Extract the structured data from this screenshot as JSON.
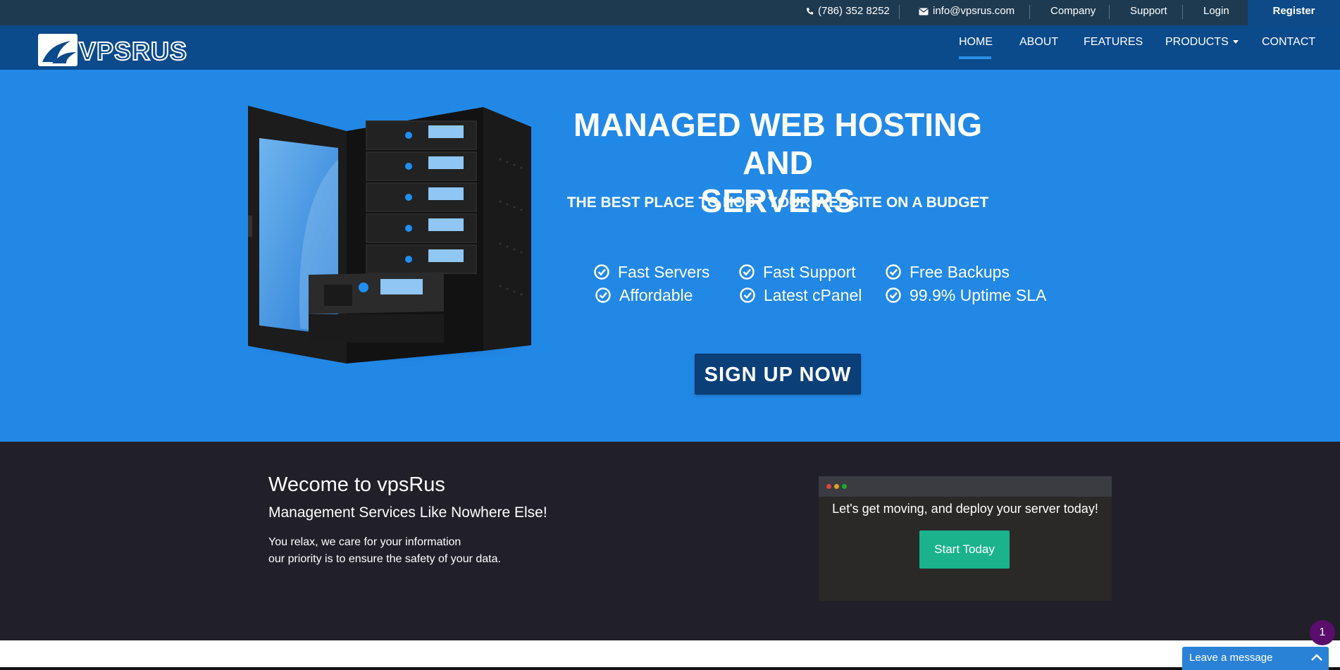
{
  "topbar": {
    "phone": "(786) 352 8252",
    "email": "info@vpsrus.com",
    "links": [
      "Company",
      "Support",
      "Login"
    ],
    "register": "Register"
  },
  "nav": {
    "logo_text": "VPSRUS",
    "items": [
      "HOME",
      "ABOUT",
      "FEATURES",
      "PRODUCTS",
      "CONTACT"
    ],
    "active": "HOME"
  },
  "hero": {
    "title_line1": "MANAGED WEB HOSTING AND",
    "title_line2": "SERVERS",
    "subtitle": "THE BEST PLACE TO HOST YOUR WEBSITE ON A BUDGET",
    "features": [
      "Fast Servers",
      "Fast Support",
      "Free Backups",
      "Affordable",
      "Latest cPanel",
      "99.9% Uptime SLA"
    ],
    "cta": "SIGN UP NOW"
  },
  "welcome": {
    "title": "Wecome to vpsRus",
    "subtitle": "Management Services Like Nowhere Else!",
    "line1": "You relax, we care for your information",
    "line2": "our priority is to ensure the safety of your data."
  },
  "deploy_card": {
    "text": "Let's get moving, and deploy your server today!",
    "button": "Start Today"
  },
  "widgets": {
    "notification_count": "1",
    "chat_label": "Leave a message"
  },
  "colors": {
    "topbar": "#1e3a50",
    "navbar": "#0b4a8b",
    "hero": "#2288e6",
    "dark": "#211f28",
    "accent_green": "#1bb38c"
  }
}
